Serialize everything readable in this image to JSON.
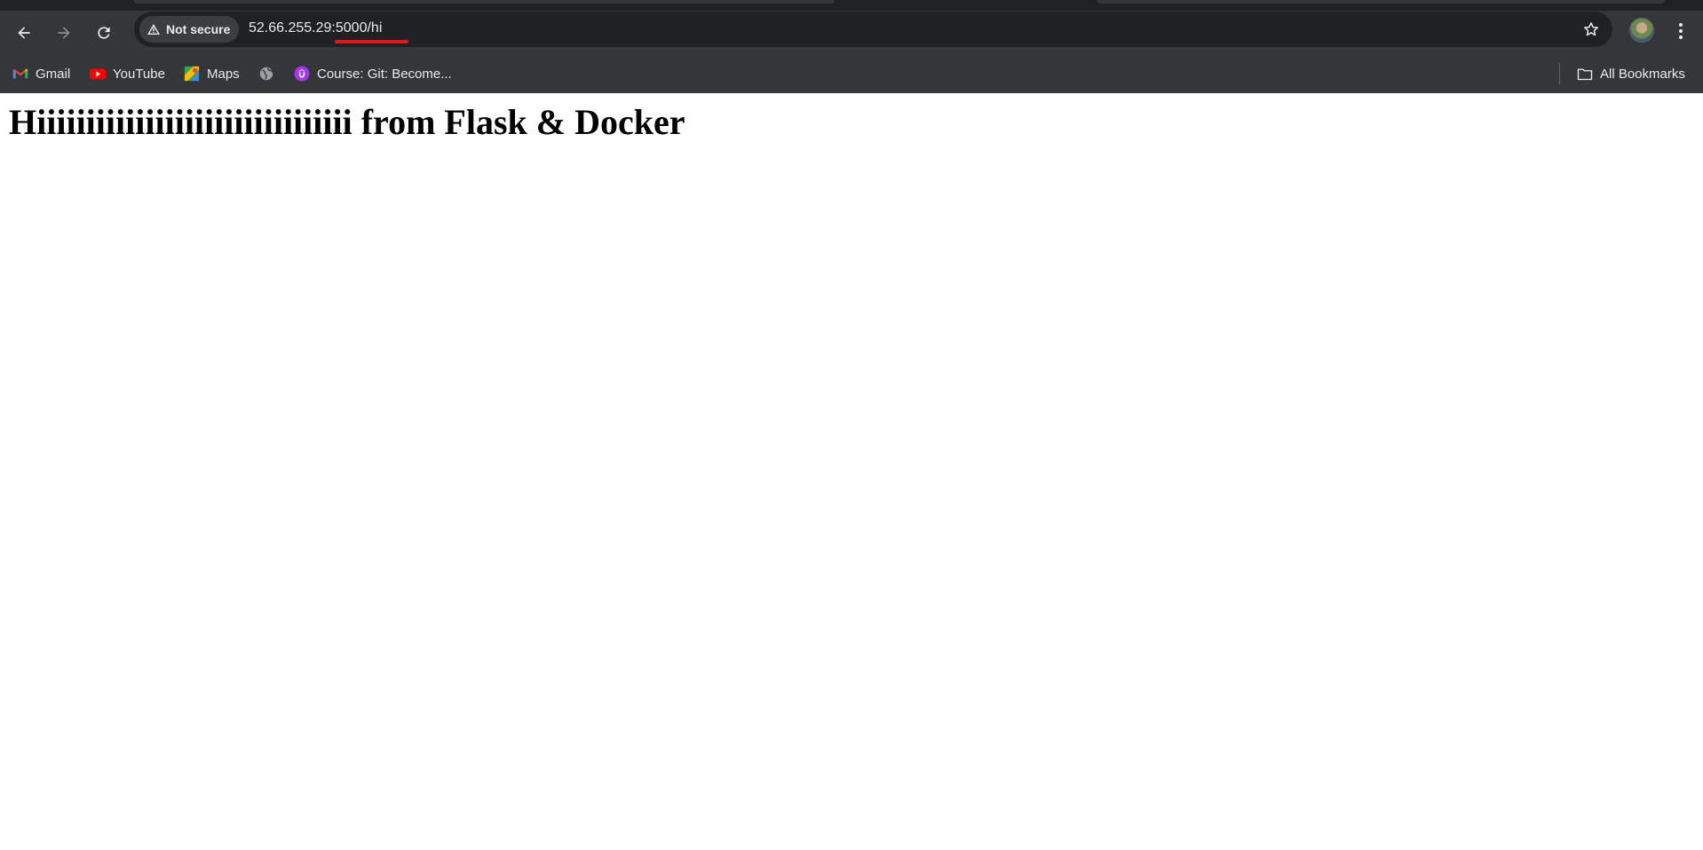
{
  "browser": {
    "security_chip": "Not secure",
    "url_host": "52.66.255.29:",
    "url_rest": "5000/hi",
    "bookmarks": [
      {
        "label": "Gmail",
        "icon": "gmail-icon"
      },
      {
        "label": "YouTube",
        "icon": "youtube-icon"
      },
      {
        "label": "Maps",
        "icon": "maps-icon"
      },
      {
        "label": "",
        "icon": "globe-icon"
      },
      {
        "label": "Course: Git: Become...",
        "icon": "udemy-icon"
      }
    ],
    "all_bookmarks": "All Bookmarks"
  },
  "page": {
    "heading": "Hiiiiiiiiiiiiiiiiiiiiiiiiiiiiiiii from Flask & Docker"
  },
  "colors": {
    "toolbar": "#35363a",
    "omnibox": "#202124",
    "annotation_underline": "#e8141c"
  }
}
